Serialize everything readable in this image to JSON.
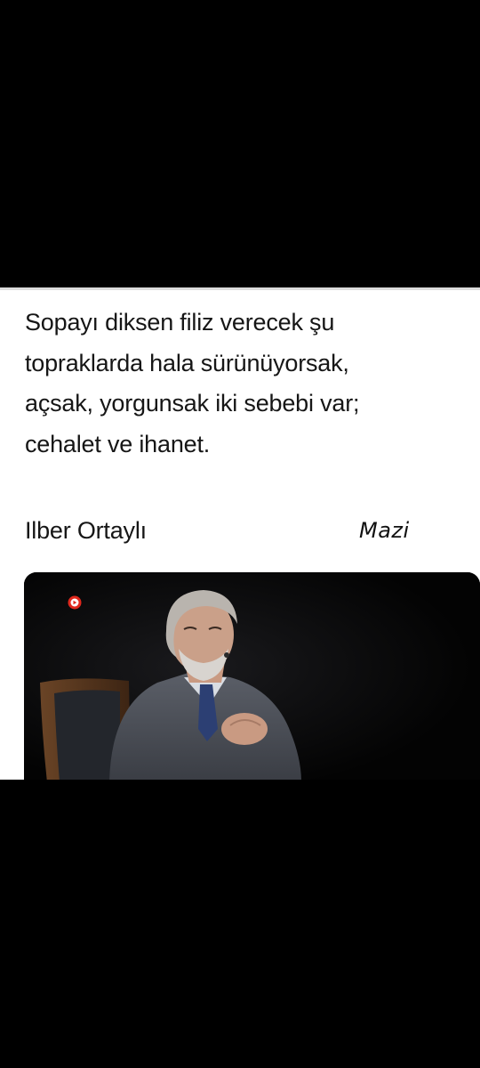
{
  "post": {
    "quote_lines": [
      "Sopayı diksen filiz verecek şu",
      "topraklarda hala sürünüyorsak,",
      "açsak, yorgunsak iki sebebi var;",
      "cehalet ve ihanet."
    ],
    "author": "Ilber Ortaylı",
    "watermark": "Mazi"
  },
  "image": {
    "background_color": "#050505",
    "record_indicator_color": "#e0281d",
    "icon": "record-play-icon"
  }
}
